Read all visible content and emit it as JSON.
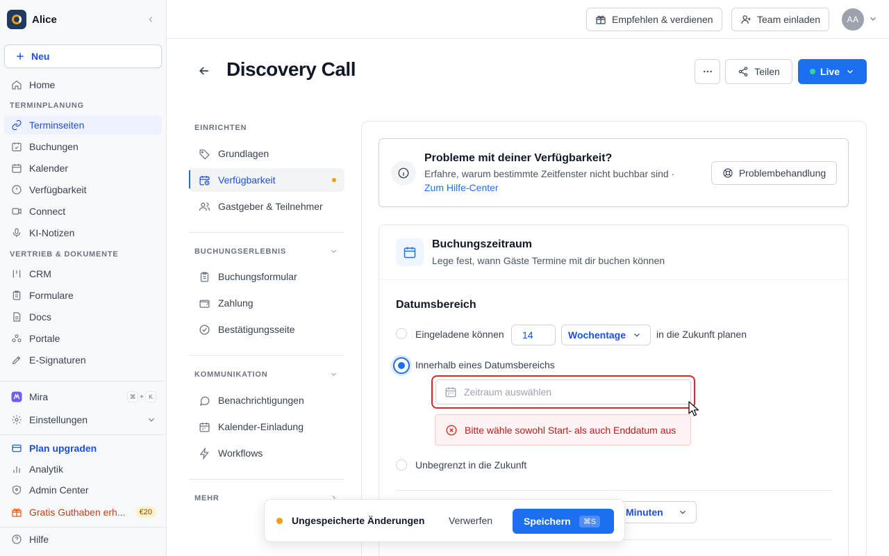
{
  "workspace": {
    "name": "Alice"
  },
  "sidebar": {
    "new_label": "Neu",
    "home_label": "Home",
    "section_scheduling": "TERMINPLANUNG",
    "scheduling_items": [
      {
        "label": "Terminseiten",
        "icon": "link-icon",
        "active": true
      },
      {
        "label": "Buchungen",
        "icon": "calendar-check-icon"
      },
      {
        "label": "Kalender",
        "icon": "calendar-icon"
      },
      {
        "label": "Verfügbarkeit",
        "icon": "clock-icon"
      },
      {
        "label": "Connect",
        "icon": "video-icon"
      },
      {
        "label": "KI-Notizen",
        "icon": "mic-icon"
      }
    ],
    "section_sales": "VERTRIEB & DOKUMENTE",
    "sales_items": [
      {
        "label": "CRM",
        "icon": "crm-icon"
      },
      {
        "label": "Formulare",
        "icon": "clipboard-icon"
      },
      {
        "label": "Docs",
        "icon": "document-icon"
      },
      {
        "label": "Portale",
        "icon": "portal-icon"
      },
      {
        "label": "E-Signaturen",
        "icon": "pen-icon"
      }
    ],
    "mira_label": "Mira",
    "mira_shortcut": [
      "⌘",
      "+",
      "K"
    ],
    "settings_label": "Einstellungen",
    "upgrade_label": "Plan upgraden",
    "analytics_label": "Analytik",
    "admin_label": "Admin Center",
    "credit_label": "Gratis Guthaben erh...",
    "credit_badge": "€20",
    "help_label": "Hilfe"
  },
  "topbar": {
    "refer_label": "Empfehlen & verdienen",
    "invite_label": "Team einladen",
    "avatar_initials": "AA"
  },
  "page": {
    "title": "Discovery Call",
    "share_label": "Teilen",
    "live_label": "Live"
  },
  "subnav": {
    "section_setup": "EINRICHTEN",
    "setup_items": [
      {
        "label": "Grundlagen",
        "icon": "tag-icon"
      },
      {
        "label": "Verfügbarkeit",
        "icon": "calendar-clock-icon",
        "active": true
      },
      {
        "label": "Gastgeber & Teilnehmer",
        "icon": "users-icon"
      }
    ],
    "section_booking": "BUCHUNGSERLEBNIS",
    "booking_items": [
      {
        "label": "Buchungsformular",
        "icon": "clipboard-icon"
      },
      {
        "label": "Zahlung",
        "icon": "wallet-icon"
      },
      {
        "label": "Bestätigungsseite",
        "icon": "check-circle-icon"
      }
    ],
    "section_comm": "KOMMUNIKATION",
    "comm_items": [
      {
        "label": "Benachrichtigungen",
        "icon": "chat-icon"
      },
      {
        "label": "Kalender-Einladung",
        "icon": "calendar-icon"
      },
      {
        "label": "Workflows",
        "icon": "bolt-icon"
      }
    ],
    "section_more": "MEHR"
  },
  "info": {
    "title": "Probleme mit deiner Verfügbarkeit?",
    "desc": "Erfahre, warum bestimmte Zeitfenster nicht buchbar sind ·",
    "link": "Zum Hilfe-Center",
    "button": "Problembehandlung"
  },
  "booking_window": {
    "title": "Buchungszeitraum",
    "desc": "Lege fest, wann Gäste Termine mit dir buchen können",
    "range_title": "Datumsbereich",
    "option_rolling_prefix": "Eingeladene können",
    "option_rolling_days": "14",
    "option_rolling_unit": "Wochentage",
    "option_rolling_suffix": "in die Zukunft planen",
    "option_range_label": "Innerhalb eines Datumsbereichs",
    "option_range_selected": true,
    "date_placeholder": "Zeitraum auswählen",
    "error_text": "Bitte wähle sowohl Start- als auch Enddatum aus",
    "option_unlimited_label": "Unbegrenzt in die Zukunft",
    "minutes_label": "Minuten"
  },
  "unsaved": {
    "text": "Ungespeicherte Änderungen",
    "discard": "Verwerfen",
    "save": "Speichern",
    "shortcut": "⌘S"
  },
  "colors": {
    "accent": "#1d6ff2",
    "error": "#dc2626",
    "warning_dot": "#f59e0b",
    "live_dot": "#34d399"
  }
}
